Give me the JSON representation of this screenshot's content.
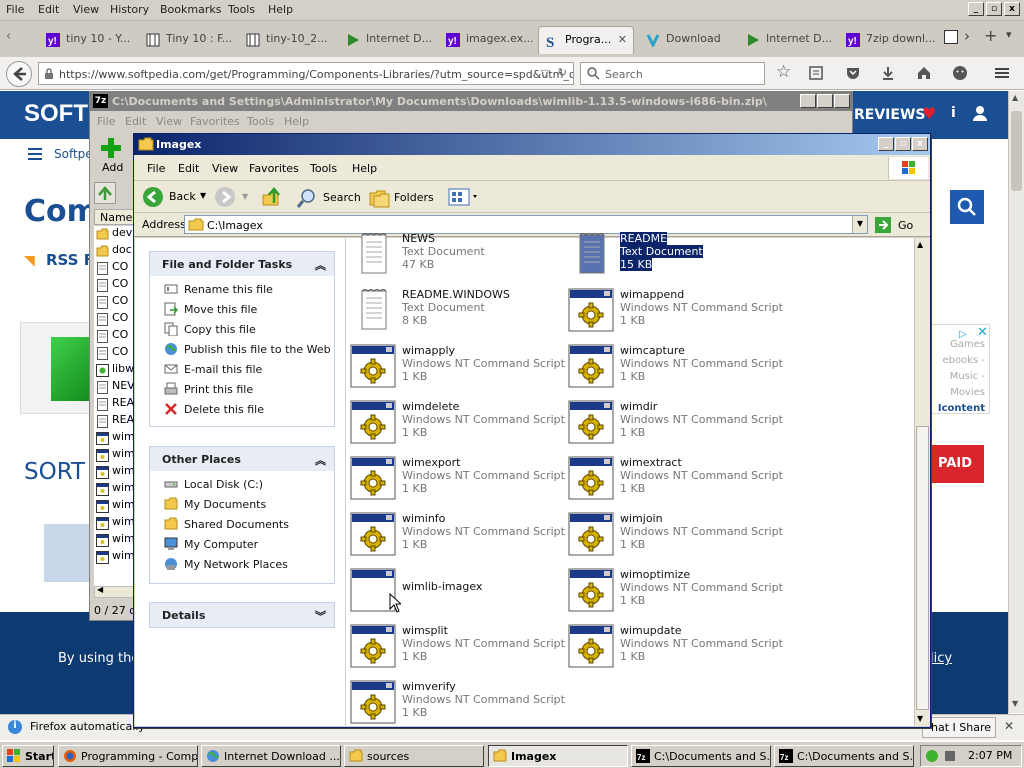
{
  "firefox": {
    "menu": [
      "File",
      "Edit",
      "View",
      "History",
      "Bookmarks",
      "Tools",
      "Help"
    ],
    "tabs": [
      {
        "label": "tiny 10 - Y...",
        "icon": "yahoo-icon"
      },
      {
        "label": "Tiny 10 : F...",
        "icon": "page-icon"
      },
      {
        "label": "tiny-10_2...",
        "icon": "page-icon"
      },
      {
        "label": "Internet D...",
        "icon": "idm-icon"
      },
      {
        "label": "imagex.ex...",
        "icon": "yahoo-icon"
      },
      {
        "label": "Progra...",
        "icon": "softpedia-icon",
        "active": true
      },
      {
        "label": "Download",
        "icon": "download-icon"
      },
      {
        "label": "Internet D...",
        "icon": "idm-icon"
      },
      {
        "label": "7zip downl...",
        "icon": "yahoo-icon"
      }
    ],
    "url": "https://www.softpedia.com/get/Programming/Components-Libraries/?utm_source=spd&utm_camp",
    "search_placeholder": "Search",
    "notification": "Firefox automatically"
  },
  "page": {
    "logo": "SOFT",
    "reviews": "REVIEWS",
    "nav_label": "Softpe",
    "heading": "Com",
    "rss": "RSS Fe",
    "sort": "SORT I",
    "paid": "PAID",
    "footer_text": "By using the s",
    "footer_link": "licy",
    "ad_lines": [
      "Games",
      "ebooks -",
      "Music -",
      "Movies"
    ],
    "ad_link": "Icontent",
    "share": "hat I Share"
  },
  "zipwin": {
    "title": "C:\\Documents and Settings\\Administrator\\My Documents\\Downloads\\wimlib-1.13.5-windows-i686-bin.zip\\",
    "menu": [
      "File",
      "Edit",
      "View",
      "Favorites",
      "Tools",
      "Help"
    ],
    "add_label": "Add",
    "column": "Name",
    "files": [
      "dev",
      "doc",
      "CO",
      "CO",
      "CO",
      "CO",
      "CO",
      "CO",
      "libw",
      "NEV",
      "REA",
      "REA",
      "wim",
      "wim",
      "wim",
      "wim",
      "wim",
      "wim",
      "wim",
      "wim"
    ],
    "status": "0 / 27 ol"
  },
  "imagex": {
    "title": "Imagex",
    "menu": [
      "File",
      "Edit",
      "View",
      "Favorites",
      "Tools",
      "Help"
    ],
    "toolbar": {
      "back": "Back",
      "search": "Search",
      "folders": "Folders"
    },
    "address_label": "Address",
    "address": "C:\\Imagex",
    "go": "Go",
    "tasks": {
      "file_folder_title": "File and Folder Tasks",
      "file_folder_items": [
        "Rename this file",
        "Move this file",
        "Copy this file",
        "Publish this file to the Web",
        "E-mail this file",
        "Print this file",
        "Delete this file"
      ],
      "other_title": "Other Places",
      "other_items": [
        "Local Disk (C:)",
        "My Documents",
        "Shared Documents",
        "My Computer",
        "My Network Places"
      ],
      "details_title": "Details"
    },
    "files": [
      {
        "name": "NEWS",
        "type": "Text Document",
        "size": "47 KB",
        "kind": "text"
      },
      {
        "name": "README",
        "type": "Text Document",
        "size": "15 KB",
        "kind": "text",
        "selected": true
      },
      {
        "name": "README.WINDOWS",
        "type": "Text Document",
        "size": "8 KB",
        "kind": "text"
      },
      {
        "name": "wimappend",
        "type": "Windows NT Command Script",
        "size": "1 KB",
        "kind": "cmd"
      },
      {
        "name": "wimapply",
        "type": "Windows NT Command Script",
        "size": "1 KB",
        "kind": "cmd"
      },
      {
        "name": "wimcapture",
        "type": "Windows NT Command Script",
        "size": "1 KB",
        "kind": "cmd"
      },
      {
        "name": "wimdelete",
        "type": "Windows NT Command Script",
        "size": "1 KB",
        "kind": "cmd"
      },
      {
        "name": "wimdir",
        "type": "Windows NT Command Script",
        "size": "1 KB",
        "kind": "cmd"
      },
      {
        "name": "wimexport",
        "type": "Windows NT Command Script",
        "size": "1 KB",
        "kind": "cmd"
      },
      {
        "name": "wimextract",
        "type": "Windows NT Command Script",
        "size": "1 KB",
        "kind": "cmd"
      },
      {
        "name": "wiminfo",
        "type": "Windows NT Command Script",
        "size": "1 KB",
        "kind": "cmd"
      },
      {
        "name": "wimjoin",
        "type": "Windows NT Command Script",
        "size": "1 KB",
        "kind": "cmd"
      },
      {
        "name": "wimlib-imagex",
        "type": "",
        "size": "",
        "kind": "exe"
      },
      {
        "name": "wimoptimize",
        "type": "Windows NT Command Script",
        "size": "1 KB",
        "kind": "cmd"
      },
      {
        "name": "wimsplit",
        "type": "Windows NT Command Script",
        "size": "1 KB",
        "kind": "cmd"
      },
      {
        "name": "wimupdate",
        "type": "Windows NT Command Script",
        "size": "1 KB",
        "kind": "cmd"
      },
      {
        "name": "wimverify",
        "type": "Windows NT Command Script",
        "size": "1 KB",
        "kind": "cmd"
      }
    ]
  },
  "taskbar": {
    "start": "Start",
    "buttons": [
      "Programming - Comp...",
      "Internet Download ...",
      "sources",
      "Imagex",
      "C:\\Documents and S...",
      "C:\\Documents and S..."
    ],
    "clock": "2:07 PM"
  }
}
